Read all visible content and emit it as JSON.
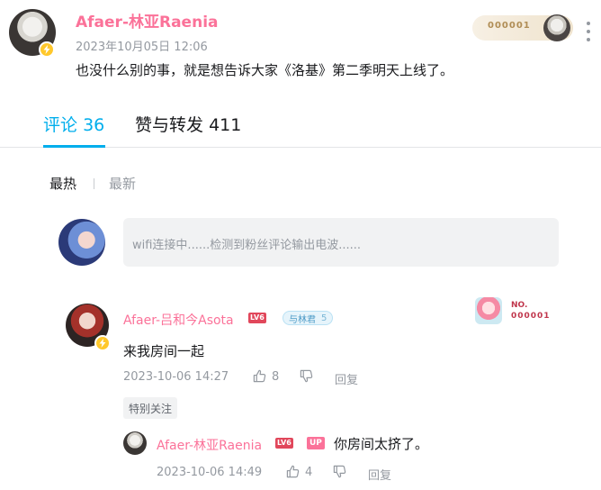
{
  "post": {
    "author": "Afaer-林亚Raenia",
    "time": "2023年10月05日 12:06",
    "text": "也没什么别的事，就是想告诉大家《洛基》第二季明天上线了。",
    "fan_card_number": "000001"
  },
  "tabs": {
    "comments_label": "评论",
    "comments_count": "36",
    "reposts_label": "赞与转发",
    "reposts_count": "411"
  },
  "sort": {
    "hot": "最热",
    "new": "最新"
  },
  "reply_box": {
    "placeholder": "wifi连接中......检测到粉丝评论输出电波......"
  },
  "comment": {
    "author": "Afaer-吕和今Asota",
    "level": "LV6",
    "fan_medal_name": "与林君",
    "fan_medal_level": "5",
    "text": "来我房间一起",
    "time": "2023-10-06 14:27",
    "likes": "8",
    "reply_label": "回复",
    "tag": "特别关注",
    "decoration_prefix": "NO.",
    "decoration_number": "000001"
  },
  "sub_reply": {
    "author": "Afaer-林亚Raenia",
    "level": "LV6",
    "up_tag": "UP",
    "text": "你房间太挤了。",
    "time": "2023-10-06 14:49",
    "likes": "4",
    "reply_label": "回复"
  },
  "colors": {
    "accent": "#00aeec",
    "username_pink": "#fb7299",
    "muted_text": "#9499a0",
    "verified_badge": "#ffc82c"
  }
}
